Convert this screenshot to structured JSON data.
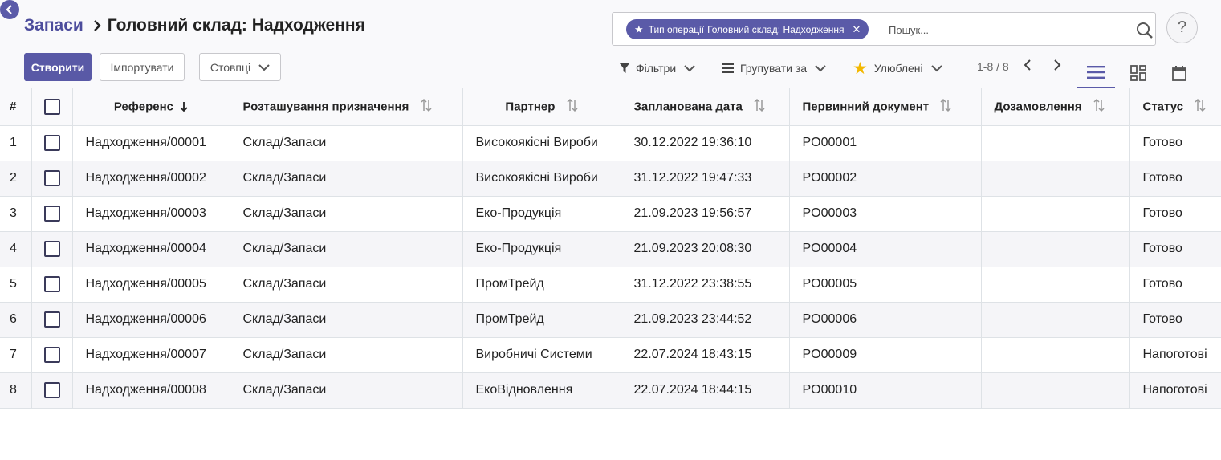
{
  "breadcrumb": {
    "parent": "Запаси",
    "current": "Головний склад: Надходження"
  },
  "toolbar": {
    "create_label": "Створити",
    "import_label": "Імпортувати",
    "columns_label": "Стовпці"
  },
  "search": {
    "facet_label": "Тип операції",
    "facet_value": "Головний склад: Надходження",
    "placeholder": "Пошук..."
  },
  "help": {
    "label": "?"
  },
  "controls": {
    "filters_label": "Фільтри",
    "group_by_label": "Групувати за",
    "favorites_label": "Улюблені",
    "pager_text": "1-8 / 8"
  },
  "colors": {
    "accent": "#5a5aa8",
    "star": "#f3b800"
  },
  "table": {
    "headers": {
      "num": "#",
      "reference": "Референс",
      "destination": "Розташування призначення",
      "partner": "Партнер",
      "scheduled_date": "Запланована дата",
      "source_document": "Первинний документ",
      "backorder": "Дозамовлення",
      "status": "Статус"
    },
    "rows": [
      {
        "num": "1",
        "reference": "Надходження/00001",
        "destination": "Склад/Запаси",
        "partner": "Високоякісні Вироби",
        "scheduled_date": "30.12.2022 19:36:10",
        "source_document": "PO00001",
        "backorder": "",
        "status": "Готово"
      },
      {
        "num": "2",
        "reference": "Надходження/00002",
        "destination": "Склад/Запаси",
        "partner": "Високоякісні Вироби",
        "scheduled_date": "31.12.2022 19:47:33",
        "source_document": "PO00002",
        "backorder": "",
        "status": "Готово"
      },
      {
        "num": "3",
        "reference": "Надходження/00003",
        "destination": "Склад/Запаси",
        "partner": "Еко-Продукція",
        "scheduled_date": "21.09.2023 19:56:57",
        "source_document": "PO00003",
        "backorder": "",
        "status": "Готово"
      },
      {
        "num": "4",
        "reference": "Надходження/00004",
        "destination": "Склад/Запаси",
        "partner": "Еко-Продукція",
        "scheduled_date": "21.09.2023 20:08:30",
        "source_document": "PO00004",
        "backorder": "",
        "status": "Готово"
      },
      {
        "num": "5",
        "reference": "Надходження/00005",
        "destination": "Склад/Запаси",
        "partner": "ПромТрейд",
        "scheduled_date": "31.12.2022 23:38:55",
        "source_document": "PO00005",
        "backorder": "",
        "status": "Готово"
      },
      {
        "num": "6",
        "reference": "Надходження/00006",
        "destination": "Склад/Запаси",
        "partner": "ПромТрейд",
        "scheduled_date": "21.09.2023 23:44:52",
        "source_document": "PO00006",
        "backorder": "",
        "status": "Готово"
      },
      {
        "num": "7",
        "reference": "Надходження/00007",
        "destination": "Склад/Запаси",
        "partner": "Виробничі Системи",
        "scheduled_date": "22.07.2024 18:43:15",
        "source_document": "PO00009",
        "backorder": "",
        "status": "Напоготові"
      },
      {
        "num": "8",
        "reference": "Надходження/00008",
        "destination": "Склад/Запаси",
        "partner": "ЕкоВідновлення",
        "scheduled_date": "22.07.2024 18:44:15",
        "source_document": "PO00010",
        "backorder": "",
        "status": "Напоготові"
      }
    ]
  }
}
